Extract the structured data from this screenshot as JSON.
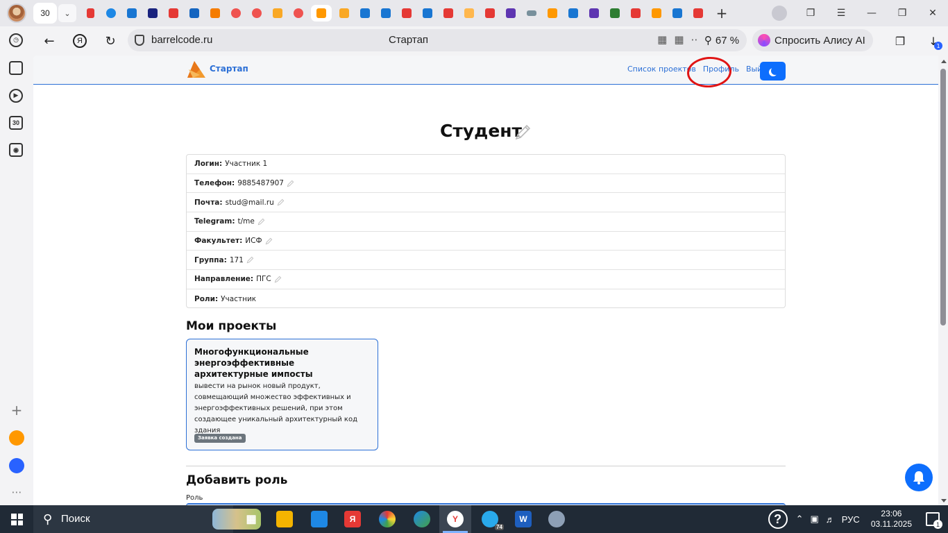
{
  "browser": {
    "active_tab_label": "30",
    "url_host": "barrelcode.ru",
    "page_title": "Стартап",
    "zoom": "67 %",
    "alice_label": "Спросить Алису AI",
    "downloads_count": "1",
    "sidebar_calendar_label": "30"
  },
  "site": {
    "logo_text": "Стартап",
    "nav": {
      "projects": "Список проектов",
      "profile": "Профиль",
      "logout": "Выйти"
    }
  },
  "profile": {
    "title": "Студент",
    "fields": [
      {
        "label": "Логин:",
        "value": "Участник 1",
        "editable": false
      },
      {
        "label": "Телефон:",
        "value": "9885487907",
        "editable": true
      },
      {
        "label": "Почта:",
        "value": "stud@mail.ru",
        "editable": true
      },
      {
        "label": "Telegram:",
        "value": "t/me",
        "editable": true
      },
      {
        "label": "Факультет:",
        "value": "ИСФ",
        "editable": true
      },
      {
        "label": "Группа:",
        "value": "171",
        "editable": true
      },
      {
        "label": "Направление:",
        "value": "ПГС",
        "editable": true
      },
      {
        "label": "Роли:",
        "value": "Участник",
        "editable": false
      }
    ]
  },
  "projects": {
    "heading": "Мои проекты",
    "items": [
      {
        "title": "Многофункциональные энергоэффективные архитектурные импосты",
        "description": "вывести на рынок новый продукт, совмещающий множество эффективных и энергоэффективных решений, при этом создающее уникальный архитектурный код здания",
        "status": "Заявка создана"
      }
    ]
  },
  "add_role": {
    "heading": "Добавить роль",
    "field_label": "Роль"
  },
  "taskbar": {
    "search_label": "Поиск",
    "language": "РУС",
    "time": "23:06",
    "date": "03.11.2025",
    "telegram_badge": "74",
    "notifications_count": "1"
  },
  "colors": {
    "accent": "#2b6fd6",
    "primary_button": "#0d6efd",
    "highlight_ring": "#e01414",
    "badge_gray": "#6c757d"
  }
}
